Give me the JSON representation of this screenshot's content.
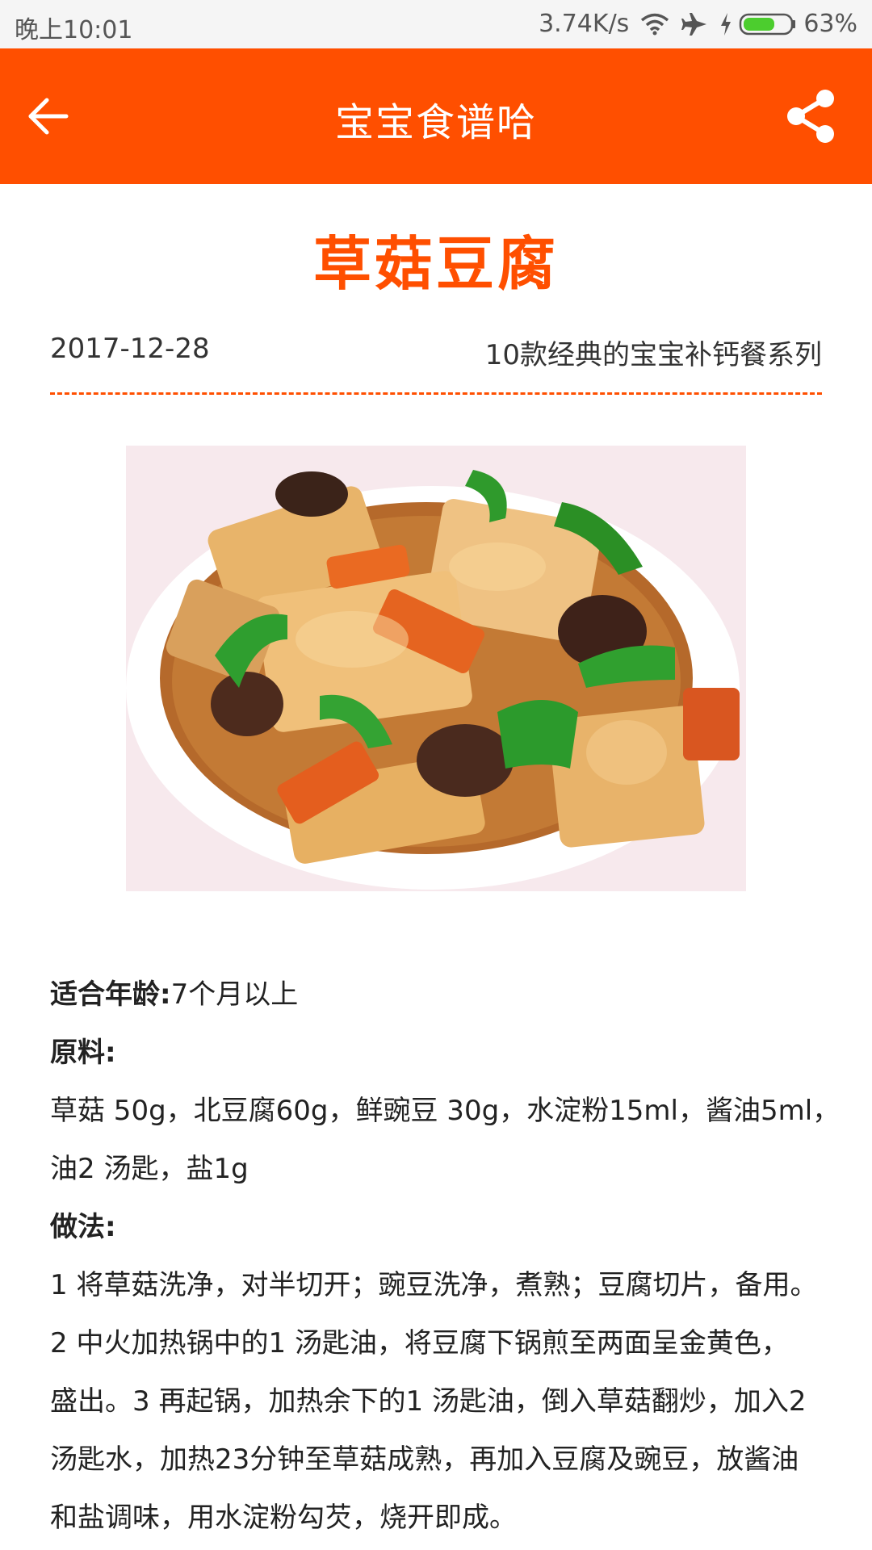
{
  "status_bar": {
    "time": "晚上10:01",
    "speed": "3.74K/s",
    "battery": "63%",
    "icons": [
      "wifi-icon",
      "airplane-icon",
      "charging-icon",
      "battery-icon"
    ]
  },
  "app_bar": {
    "title": "宝宝食谱哈",
    "back_icon": "arrow-left-icon",
    "share_icon": "share-icon",
    "color": "#ff4f00"
  },
  "recipe": {
    "title": "草菇豆腐",
    "date": "2017-12-28",
    "series": "10款经典的宝宝补钙餐系列",
    "age_label": "适合年龄:",
    "age_value": "7个月以上",
    "ingredients_label": "原料:",
    "ingredients_lines": [
      "草菇 50g，北豆腐60g，鲜豌豆 30g，水淀粉15ml，酱油5ml，",
      "油2 汤匙，盐1g"
    ],
    "method_label": "做法:",
    "method_lines": [
      "1 将草菇洗净，对半切开；豌豆洗净，煮熟；豆腐切片，备用。",
      "2 中火加热锅中的1 汤匙油，将豆腐下锅煎至两面呈金黄色，",
      "盛出。3 再起锅，加热余下的1 汤匙油，倒入草菇翻炒，加入2",
      "汤匙水，加热23分钟至草菇成熟，再加入豆腐及豌豆，放酱油",
      "和盐调味，用水淀粉勾芡，烧开即成。"
    ]
  }
}
